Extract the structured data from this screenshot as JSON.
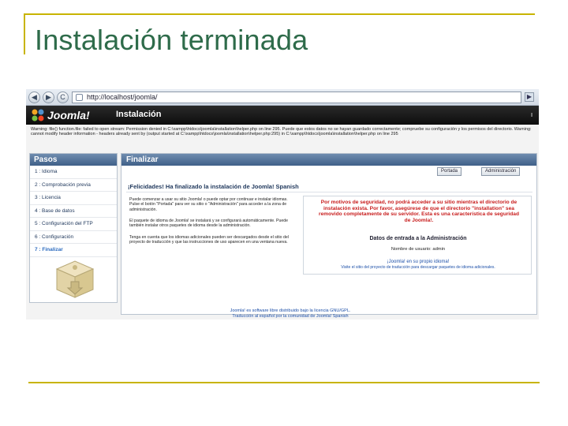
{
  "slide": {
    "title": "Instalación terminada"
  },
  "browser": {
    "back": "◀",
    "forward": "▶",
    "reload": "C",
    "home": "⌂",
    "url": "http://localhost/joomla/",
    "go": "▶"
  },
  "joomla": {
    "logo": "Joomla!",
    "header_title": "Instalación",
    "header_right": "Ⅰ",
    "warning": "Warning: file() function.file: failed to open stream: Permission denied in C:\\xampp\\htdocs\\joomla\\installation\\helper.php on line 295. Puede que estos datos no se hayan guardado correctamente; compruebe su configuración y los permisos del directorio. Warning: cannot modify header information - headers already sent by (output started at C:\\xampp\\htdocs\\joomla\\installation\\helper.php:295) in C:\\xampp\\htdocs\\joomla\\installation\\helper.php on line 295",
    "sidebar": {
      "title": "Pasos",
      "steps": [
        "1 : Idioma",
        "2 : Comprobación previa",
        "3 : Licencia",
        "4 : Base de datos",
        "5 : Configuración del FTP",
        "6 : Configuración",
        "7 : Finalizar"
      ]
    },
    "main": {
      "title": "Finalizar",
      "btn_site": "Portada",
      "btn_admin": "Administración",
      "congrats": "¡Felicidades! Ha finalizado la instalación de Joomla! Spanish",
      "para1": "Puede comenzar a usar su sitio Joomla! o puede optar por continuar e instalar idiomas. Pulse el botón \"Portada\" para ver su sitio o \"Administración\" para acceder a la zona de administración.",
      "para2": "El paquete de idioma de Joomla! se instalará y se configurará automáticamente. Puede también instalar otros paquetes de idioma desde la administración.",
      "para3": "Tenga en cuenta que los idiomas adicionales pueden ser descargados desde el sitio del proyecto de traducción y que las instrucciones de uso aparecen en una ventana nueva.",
      "red_notice": "Por motivos de seguridad, no podrá acceder a su sitio mientras el directorio de instalación exista. Por favor, asegúrese de que el directorio \"installation\" sea removido completamente de su servidor. Esta es una característica de seguridad de Joomla!.",
      "admin_title": "Datos de entrada a la Administración",
      "user_line": "Nombre de usuario: admin",
      "link": "¡Joomla! en su propio idioma!",
      "link_sub": "Visite el sitio del proyecto de traducción para descargar paquetes de idioma adicionales."
    },
    "footer": [
      "Joomla! es software libre distribuido bajo la licencia GNU/GPL.",
      "Traducción al español por la comunidad de Joomla! Spanish"
    ]
  },
  "colors": {
    "accent_rule": "#c8b400",
    "title_green": "#2e6b4a",
    "notice_red": "#c81d1d"
  }
}
